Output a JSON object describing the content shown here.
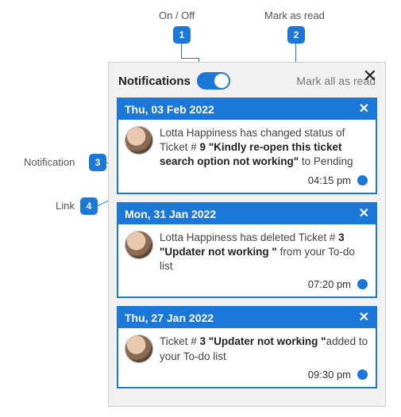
{
  "callouts": {
    "c1": {
      "label": "On / Off",
      "num": "1"
    },
    "c2": {
      "label": "Mark as read",
      "num": "2"
    },
    "c3": {
      "label": "Notification",
      "num": "3"
    },
    "c4": {
      "label": "Link",
      "num": "4"
    }
  },
  "panel": {
    "title": "Notifications",
    "mark_all": "Mark all as read",
    "close": "✕"
  },
  "cards": [
    {
      "date": "Thu, 03 Feb 2022",
      "close": "✕",
      "msg_pre": "Lotta Happiness has changed status of Ticket # ",
      "msg_bold": "9 \"Kindly re-open this ticket search option not working\"",
      "msg_post": " to Pending",
      "time": "04:15 pm"
    },
    {
      "date": "Mon, 31 Jan 2022",
      "close": "✕",
      "msg_pre": "Lotta Happiness has deleted Ticket # ",
      "msg_bold": "3 \"Updater not working \"",
      "msg_post": " from your To-do list",
      "time": "07:20 pm"
    },
    {
      "date": "Thu, 27 Jan 2022",
      "close": "✕",
      "msg_pre": "Ticket # ",
      "msg_bold": "3 \"Updater not working \"",
      "msg_post": "added to your To-do list",
      "time": "09:30 pm"
    }
  ]
}
